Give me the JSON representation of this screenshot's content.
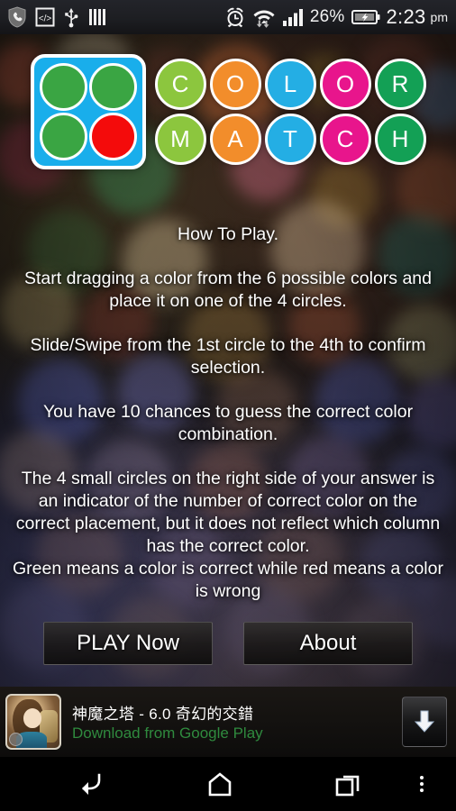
{
  "statusbar": {
    "left_icons": [
      {
        "name": "shield-phone-icon"
      },
      {
        "name": "code-brackets-icon"
      },
      {
        "name": "usb-icon"
      },
      {
        "name": "vertical-bars-icon"
      }
    ],
    "alarm_icon": "alarm-clock-icon",
    "wifi_icon": "wifi-data-transfer-icon",
    "signal_icon": "cellular-signal-icon",
    "battery_percent": "26%",
    "battery_icon": "battery-charging-icon",
    "time": "2:23",
    "ampm": "pm"
  },
  "logo": {
    "icon_name": "color-match-app-icon",
    "icon_bg": "#19aeeb",
    "icon_dots": [
      {
        "color": "#3aa543",
        "name": "logo-dot-green-1"
      },
      {
        "color": "#3aa543",
        "name": "logo-dot-green-2"
      },
      {
        "color": "#3aa543",
        "name": "logo-dot-green-3"
      },
      {
        "color": "#f40b0b",
        "name": "logo-dot-red"
      }
    ],
    "row1": [
      {
        "letter": "C",
        "color": "#8cc63e"
      },
      {
        "letter": "O",
        "color": "#f28d2b"
      },
      {
        "letter": "L",
        "color": "#24aee4"
      },
      {
        "letter": "O",
        "color": "#e8158c"
      },
      {
        "letter": "R",
        "color": "#13a055"
      }
    ],
    "row2": [
      {
        "letter": "M",
        "color": "#8cc63e"
      },
      {
        "letter": "A",
        "color": "#f28d2b"
      },
      {
        "letter": "T",
        "color": "#24aee4"
      },
      {
        "letter": "C",
        "color": "#e8158c"
      },
      {
        "letter": "H",
        "color": "#13a055"
      }
    ]
  },
  "instructions": {
    "title": "How To Play.",
    "p1": "Start dragging a color from the 6 possible colors and place it on one of the 4 circles.",
    "p2": "Slide/Swipe from the 1st circle to the 4th to confirm selection.",
    "p3": "You have 10 chances to guess the correct color combination.",
    "p4": "The 4 small circles on the right side of your answer is an indicator of the number of correct color on the correct placement, but it does not reflect which column has the correct color.",
    "p5": "Green means a color is correct while red means a color is wrong"
  },
  "buttons": {
    "play": "PLAY Now",
    "about": "About"
  },
  "ad": {
    "thumb_name": "ad-app-icon",
    "title": "神魔之塔 - 6.0 奇幻的交錯",
    "subtitle": "Download from Google Play",
    "subtitle_color": "#2f8a3e",
    "download_icon": "download-arrow-icon"
  },
  "navbar": {
    "back": "back-icon",
    "home": "home-icon",
    "recents": "recent-apps-icon",
    "menu": "overflow-menu-icon"
  }
}
